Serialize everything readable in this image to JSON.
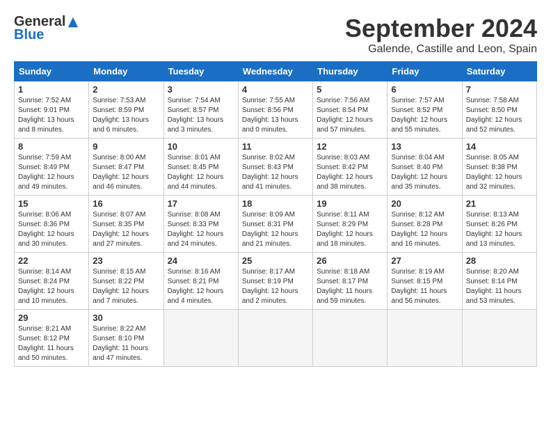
{
  "header": {
    "logo_general": "General",
    "logo_blue": "Blue",
    "month_title": "September 2024",
    "location": "Galende, Castille and Leon, Spain"
  },
  "weekdays": [
    "Sunday",
    "Monday",
    "Tuesday",
    "Wednesday",
    "Thursday",
    "Friday",
    "Saturday"
  ],
  "weeks": [
    [
      {
        "day": "1",
        "sunrise": "7:52 AM",
        "sunset": "9:01 PM",
        "daylight": "13 hours and 8 minutes."
      },
      {
        "day": "2",
        "sunrise": "7:53 AM",
        "sunset": "8:59 PM",
        "daylight": "13 hours and 6 minutes."
      },
      {
        "day": "3",
        "sunrise": "7:54 AM",
        "sunset": "8:57 PM",
        "daylight": "13 hours and 3 minutes."
      },
      {
        "day": "4",
        "sunrise": "7:55 AM",
        "sunset": "8:56 PM",
        "daylight": "13 hours and 0 minutes."
      },
      {
        "day": "5",
        "sunrise": "7:56 AM",
        "sunset": "8:54 PM",
        "daylight": "12 hours and 57 minutes."
      },
      {
        "day": "6",
        "sunrise": "7:57 AM",
        "sunset": "8:52 PM",
        "daylight": "12 hours and 55 minutes."
      },
      {
        "day": "7",
        "sunrise": "7:58 AM",
        "sunset": "8:50 PM",
        "daylight": "12 hours and 52 minutes."
      }
    ],
    [
      {
        "day": "8",
        "sunrise": "7:59 AM",
        "sunset": "8:49 PM",
        "daylight": "12 hours and 49 minutes."
      },
      {
        "day": "9",
        "sunrise": "8:00 AM",
        "sunset": "8:47 PM",
        "daylight": "12 hours and 46 minutes."
      },
      {
        "day": "10",
        "sunrise": "8:01 AM",
        "sunset": "8:45 PM",
        "daylight": "12 hours and 44 minutes."
      },
      {
        "day": "11",
        "sunrise": "8:02 AM",
        "sunset": "8:43 PM",
        "daylight": "12 hours and 41 minutes."
      },
      {
        "day": "12",
        "sunrise": "8:03 AM",
        "sunset": "8:42 PM",
        "daylight": "12 hours and 38 minutes."
      },
      {
        "day": "13",
        "sunrise": "8:04 AM",
        "sunset": "8:40 PM",
        "daylight": "12 hours and 35 minutes."
      },
      {
        "day": "14",
        "sunrise": "8:05 AM",
        "sunset": "8:38 PM",
        "daylight": "12 hours and 32 minutes."
      }
    ],
    [
      {
        "day": "15",
        "sunrise": "8:06 AM",
        "sunset": "8:36 PM",
        "daylight": "12 hours and 30 minutes."
      },
      {
        "day": "16",
        "sunrise": "8:07 AM",
        "sunset": "8:35 PM",
        "daylight": "12 hours and 27 minutes."
      },
      {
        "day": "17",
        "sunrise": "8:08 AM",
        "sunset": "8:33 PM",
        "daylight": "12 hours and 24 minutes."
      },
      {
        "day": "18",
        "sunrise": "8:09 AM",
        "sunset": "8:31 PM",
        "daylight": "12 hours and 21 minutes."
      },
      {
        "day": "19",
        "sunrise": "8:11 AM",
        "sunset": "8:29 PM",
        "daylight": "12 hours and 18 minutes."
      },
      {
        "day": "20",
        "sunrise": "8:12 AM",
        "sunset": "8:28 PM",
        "daylight": "12 hours and 16 minutes."
      },
      {
        "day": "21",
        "sunrise": "8:13 AM",
        "sunset": "8:26 PM",
        "daylight": "12 hours and 13 minutes."
      }
    ],
    [
      {
        "day": "22",
        "sunrise": "8:14 AM",
        "sunset": "8:24 PM",
        "daylight": "12 hours and 10 minutes."
      },
      {
        "day": "23",
        "sunrise": "8:15 AM",
        "sunset": "8:22 PM",
        "daylight": "12 hours and 7 minutes."
      },
      {
        "day": "24",
        "sunrise": "8:16 AM",
        "sunset": "8:21 PM",
        "daylight": "12 hours and 4 minutes."
      },
      {
        "day": "25",
        "sunrise": "8:17 AM",
        "sunset": "8:19 PM",
        "daylight": "12 hours and 2 minutes."
      },
      {
        "day": "26",
        "sunrise": "8:18 AM",
        "sunset": "8:17 PM",
        "daylight": "11 hours and 59 minutes."
      },
      {
        "day": "27",
        "sunrise": "8:19 AM",
        "sunset": "8:15 PM",
        "daylight": "11 hours and 56 minutes."
      },
      {
        "day": "28",
        "sunrise": "8:20 AM",
        "sunset": "8:14 PM",
        "daylight": "11 hours and 53 minutes."
      }
    ],
    [
      {
        "day": "29",
        "sunrise": "8:21 AM",
        "sunset": "8:12 PM",
        "daylight": "11 hours and 50 minutes."
      },
      {
        "day": "30",
        "sunrise": "8:22 AM",
        "sunset": "8:10 PM",
        "daylight": "11 hours and 47 minutes."
      },
      null,
      null,
      null,
      null,
      null
    ]
  ]
}
